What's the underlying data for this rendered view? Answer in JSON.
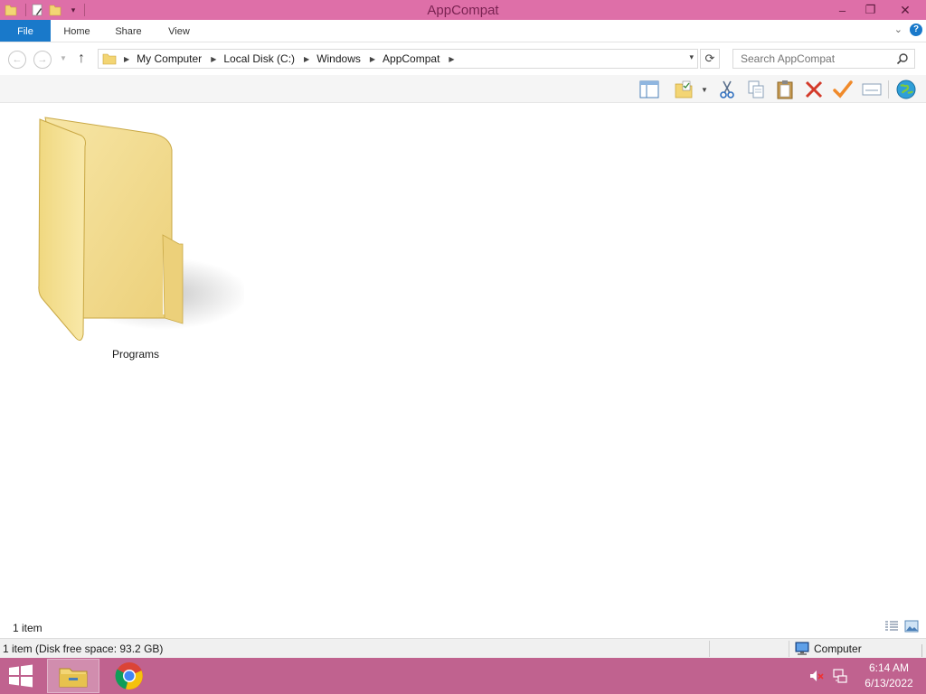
{
  "window": {
    "title": "AppCompat",
    "controls": {
      "minimize": "–",
      "restore": "❐",
      "close": "✕"
    }
  },
  "ribbon": {
    "tabs": [
      {
        "label": "File"
      },
      {
        "label": "Home"
      },
      {
        "label": "Share"
      },
      {
        "label": "View"
      }
    ]
  },
  "addressbar": {
    "breadcrumbs": [
      "My Computer",
      "Local Disk (C:)",
      "Windows",
      "AppCompat"
    ]
  },
  "search": {
    "placeholder": "Search AppCompat"
  },
  "toolbar": {
    "icons": [
      "preview-pane-icon",
      "select-folder-icon",
      "cut-icon",
      "copy-icon",
      "paste-icon",
      "delete-icon",
      "check-icon",
      "rename-icon",
      "globe-icon"
    ]
  },
  "content": {
    "items": [
      {
        "name": "Programs",
        "type": "folder"
      }
    ]
  },
  "status": {
    "count": "1 item"
  },
  "details": {
    "info": "1 item (Disk free space: 93.2 GB)",
    "location": "Computer"
  },
  "taskbar": {
    "apps": [
      "file-explorer",
      "google-chrome"
    ],
    "clock": {
      "time": "6:14 AM",
      "date": "6/13/2022"
    }
  },
  "colors": {
    "titlebar": "#de6fa8",
    "taskbar": "#c0628f",
    "file_tab": "#1979ca",
    "folder": "#f2d87a"
  }
}
